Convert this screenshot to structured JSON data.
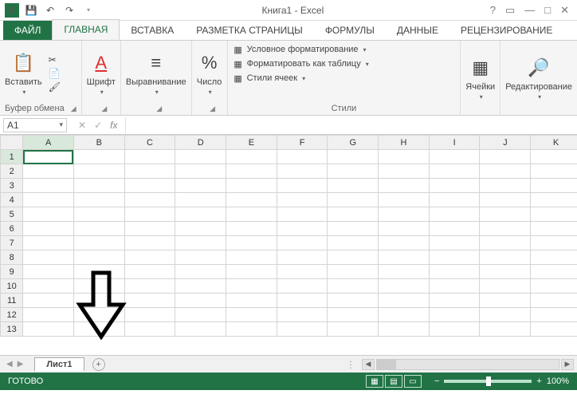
{
  "title": "Книга1 - Excel",
  "tabs": {
    "file": "ФАЙЛ",
    "home": "ГЛАВНАЯ",
    "insert": "ВСТАВКА",
    "pagelayout": "РАЗМЕТКА СТРАНИЦЫ",
    "formulas": "ФОРМУЛЫ",
    "data": "ДАННЫЕ",
    "review": "РЕЦЕНЗИРОВАНИЕ"
  },
  "ribbon": {
    "paste": "Вставить",
    "clipboard_label": "Буфер обмена",
    "font_label": "Шрифт",
    "alignment_label": "Выравнивание",
    "number_label": "Число",
    "cond_format": "Условное форматирование",
    "format_table": "Форматировать как таблицу",
    "cell_styles": "Стили ячеек",
    "styles_label": "Стили",
    "cells_label": "Ячейки",
    "edit_label": "Редактирование"
  },
  "namebox": "A1",
  "columns": [
    "A",
    "B",
    "C",
    "D",
    "E",
    "F",
    "G",
    "H",
    "I",
    "J",
    "K"
  ],
  "rows": [
    "1",
    "2",
    "3",
    "4",
    "5",
    "6",
    "7",
    "8",
    "9",
    "10",
    "11",
    "12",
    "13"
  ],
  "sheettab": "Лист1",
  "status_ready": "ГОТОВО",
  "zoom_pct": "100%"
}
